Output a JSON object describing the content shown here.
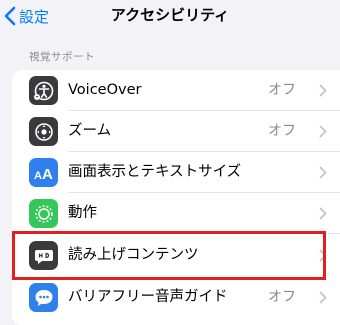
{
  "nav": {
    "back_label": "設定",
    "title": "アクセシビリティ"
  },
  "section": {
    "header": "視覚サポート"
  },
  "rows": [
    {
      "label": "VoiceOver",
      "value": "オフ",
      "icon": "voiceover-icon",
      "color": "#3a3a3c"
    },
    {
      "label": "ズーム",
      "value": "オフ",
      "icon": "zoom-icon",
      "color": "#3a3a3c"
    },
    {
      "label": "画面表示とテキストサイズ",
      "value": "",
      "icon": "text-size-icon",
      "color": "#2f80ed"
    },
    {
      "label": "動作",
      "value": "",
      "icon": "motion-icon",
      "color": "#34c759"
    },
    {
      "label": "読み上げコンテンツ",
      "value": "",
      "icon": "spoken-content-icon",
      "color": "#3a3a3c"
    },
    {
      "label": "バリアフリー音声ガイド",
      "value": "オフ",
      "icon": "audio-description-icon",
      "color": "#2f80ed"
    }
  ],
  "highlight_color": "#e0201c"
}
